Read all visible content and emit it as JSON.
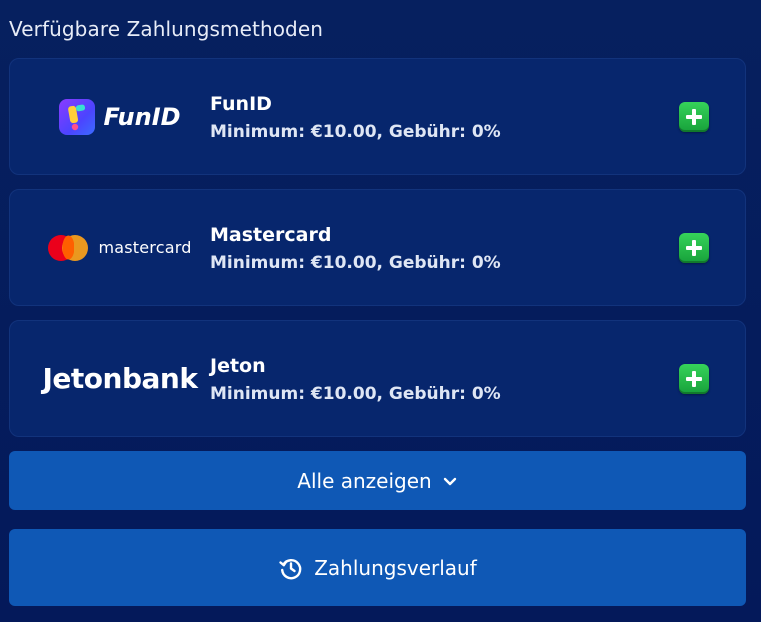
{
  "section": {
    "title": "Verfügbare Zahlungsmethoden"
  },
  "methods": [
    {
      "name": "FunID",
      "logo_text": "FunID",
      "logo_icon": "funid-logo",
      "info": "Minimum: €10.00, Gebühr: 0%"
    },
    {
      "name": "Mastercard",
      "logo_text": "mastercard",
      "logo_icon": "mastercard-logo",
      "info": "Minimum: €10.00, Gebühr: 0%"
    },
    {
      "name": "Jeton",
      "logo_text": "Jetonbank",
      "logo_icon": "jetonbank-logo",
      "info": "Minimum: €10.00, Gebühr: 0%"
    }
  ],
  "buttons": {
    "show_all": "Alle anzeigen",
    "show_all_icon": "chevron-down-icon",
    "history": "Zahlungsverlauf",
    "history_icon": "history-icon"
  },
  "colors": {
    "background": "#04195a",
    "card": "#07266d",
    "button": "#0f58b5",
    "add": "#22b648"
  }
}
